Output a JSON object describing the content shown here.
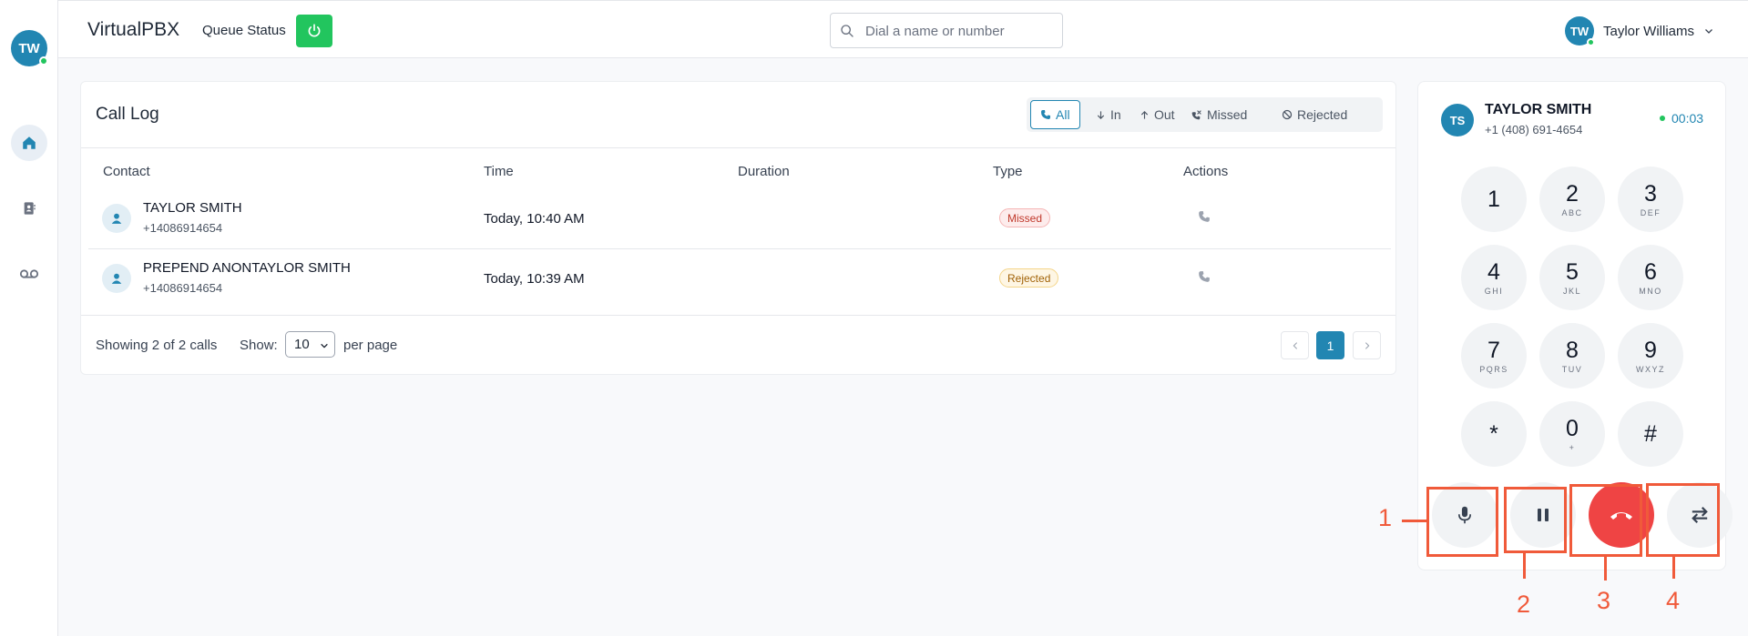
{
  "sidebar": {
    "avatar_initials": "TW",
    "items": [
      {
        "name": "home-icon",
        "active": true
      },
      {
        "name": "contacts-icon",
        "active": false
      },
      {
        "name": "voicemail-icon",
        "active": false
      }
    ]
  },
  "header": {
    "brand": "VirtualPBX",
    "queue_status_label": "Queue Status",
    "search_placeholder": "Dial a name or number",
    "user_initials": "TW",
    "user_name": "Taylor Williams"
  },
  "call_log": {
    "title": "Call Log",
    "filters": [
      {
        "label": "All",
        "active": true
      },
      {
        "label": "In",
        "active": false
      },
      {
        "label": "Out",
        "active": false
      },
      {
        "label": "Missed",
        "active": false
      },
      {
        "label": "Rejected",
        "active": false
      }
    ],
    "columns": [
      "Contact",
      "Time",
      "Duration",
      "Type",
      "Actions"
    ],
    "rows": [
      {
        "name": "TAYLOR SMITH",
        "number": "+14086914654",
        "time": "Today, 10:40 AM",
        "duration": "",
        "type": "Missed"
      },
      {
        "name": "PREPEND ANONTAYLOR SMITH",
        "number": "+14086914654",
        "time": "Today, 10:39 AM",
        "duration": "",
        "type": "Rejected"
      }
    ],
    "footer": {
      "showing": "Showing 2 of 2 calls",
      "show_label": "Show:",
      "per_page_value": "10",
      "per_page_label": "per page",
      "current_page": "1"
    }
  },
  "dialer": {
    "initials": "TS",
    "caller_name": "TAYLOR SMITH",
    "caller_number": "+1 (408) 691-4654",
    "timer": "00:03",
    "keys": [
      {
        "num": "1",
        "sub": ""
      },
      {
        "num": "2",
        "sub": "ABC"
      },
      {
        "num": "3",
        "sub": "DEF"
      },
      {
        "num": "4",
        "sub": "GHI"
      },
      {
        "num": "5",
        "sub": "JKL"
      },
      {
        "num": "6",
        "sub": "MNO"
      },
      {
        "num": "7",
        "sub": "PQRS"
      },
      {
        "num": "8",
        "sub": "TUV"
      },
      {
        "num": "9",
        "sub": "WXYZ"
      },
      {
        "num": "*",
        "sub": ""
      },
      {
        "num": "0",
        "sub": "+"
      },
      {
        "num": "#",
        "sub": ""
      }
    ],
    "controls": [
      "microphone-icon",
      "pause-icon",
      "hangup-icon",
      "transfer-icon"
    ]
  },
  "annotations": {
    "labels": [
      "1",
      "2",
      "3",
      "4"
    ],
    "color": "#f05a3a"
  },
  "colors": {
    "primary": "#2286b2",
    "success": "#22c55e",
    "danger": "#ef4444"
  }
}
